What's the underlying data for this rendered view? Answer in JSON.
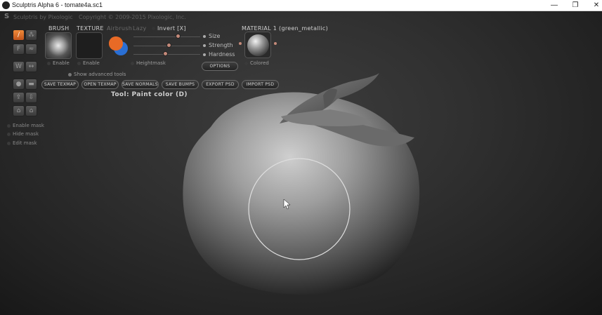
{
  "window": {
    "title": "Sculptris Alpha 6 - tomate4a.sc1",
    "minimize": "—",
    "maximize": "❐",
    "close": "✕"
  },
  "menubar": {
    "app_label": "Sculptris by Pixologic",
    "copyright": "Copyright © 2009-2015 Pixologic, Inc."
  },
  "toolbar": {
    "brush_header": "BRUSH",
    "texture_header": "TEXTURE",
    "airbrush": "Airbrush",
    "lazy": "Lazy",
    "invert": "Invert [X]",
    "enable_brush": "Enable",
    "enable_texture": "Enable",
    "heightmask": "Heightmask",
    "show_advanced": "Show advanced tools",
    "size": "Size",
    "strength": "Strength",
    "hardness": "Hardness",
    "options": "OPTIONS",
    "material_header": "MATERIAL 1 (green_metallic)",
    "colored": "Colored",
    "buttons": [
      "SAVE TEXMAP",
      "OPEN TEXMAP",
      "SAVE NORMALS",
      "SAVE BUMPS",
      "EXPORT PSD",
      "IMPORT PSD"
    ],
    "tool_label": "Tool: Paint color (D)"
  },
  "sliders": {
    "size": 0.78,
    "strength": 0.5,
    "hardness": 0.42
  },
  "colors": {
    "primary": "#e86a26",
    "secondary": "#2a6fd4",
    "active_tool": "#e8782e"
  },
  "side_tools": {
    "paint": "/",
    "bump": "⁂",
    "f": "F",
    "w": "W",
    "mask": "Enable mask",
    "hide": "Hide mask",
    "edit": "Edit mask"
  }
}
